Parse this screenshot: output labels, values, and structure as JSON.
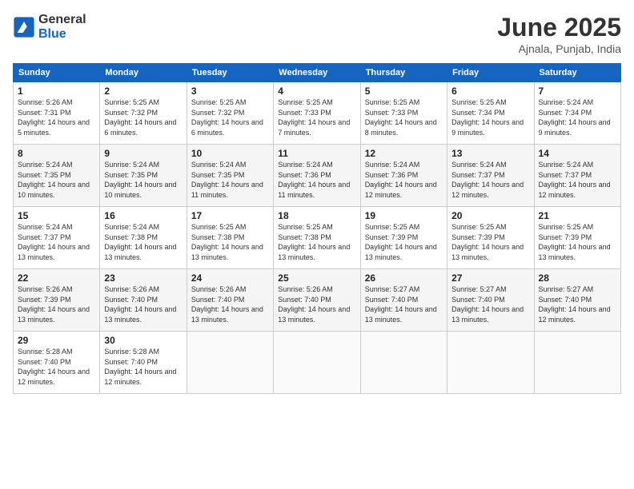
{
  "logo": {
    "general": "General",
    "blue": "Blue"
  },
  "title": "June 2025",
  "location": "Ajnala, Punjab, India",
  "weekdays": [
    "Sunday",
    "Monday",
    "Tuesday",
    "Wednesday",
    "Thursday",
    "Friday",
    "Saturday"
  ],
  "weeks": [
    [
      {
        "day": "1",
        "sunrise": "5:26 AM",
        "sunset": "7:31 PM",
        "daylight": "14 hours and 5 minutes."
      },
      {
        "day": "2",
        "sunrise": "5:25 AM",
        "sunset": "7:32 PM",
        "daylight": "14 hours and 6 minutes."
      },
      {
        "day": "3",
        "sunrise": "5:25 AM",
        "sunset": "7:32 PM",
        "daylight": "14 hours and 6 minutes."
      },
      {
        "day": "4",
        "sunrise": "5:25 AM",
        "sunset": "7:33 PM",
        "daylight": "14 hours and 7 minutes."
      },
      {
        "day": "5",
        "sunrise": "5:25 AM",
        "sunset": "7:33 PM",
        "daylight": "14 hours and 8 minutes."
      },
      {
        "day": "6",
        "sunrise": "5:25 AM",
        "sunset": "7:34 PM",
        "daylight": "14 hours and 9 minutes."
      },
      {
        "day": "7",
        "sunrise": "5:24 AM",
        "sunset": "7:34 PM",
        "daylight": "14 hours and 9 minutes."
      }
    ],
    [
      {
        "day": "8",
        "sunrise": "5:24 AM",
        "sunset": "7:35 PM",
        "daylight": "14 hours and 10 minutes."
      },
      {
        "day": "9",
        "sunrise": "5:24 AM",
        "sunset": "7:35 PM",
        "daylight": "14 hours and 10 minutes."
      },
      {
        "day": "10",
        "sunrise": "5:24 AM",
        "sunset": "7:35 PM",
        "daylight": "14 hours and 11 minutes."
      },
      {
        "day": "11",
        "sunrise": "5:24 AM",
        "sunset": "7:36 PM",
        "daylight": "14 hours and 11 minutes."
      },
      {
        "day": "12",
        "sunrise": "5:24 AM",
        "sunset": "7:36 PM",
        "daylight": "14 hours and 12 minutes."
      },
      {
        "day": "13",
        "sunrise": "5:24 AM",
        "sunset": "7:37 PM",
        "daylight": "14 hours and 12 minutes."
      },
      {
        "day": "14",
        "sunrise": "5:24 AM",
        "sunset": "7:37 PM",
        "daylight": "14 hours and 12 minutes."
      }
    ],
    [
      {
        "day": "15",
        "sunrise": "5:24 AM",
        "sunset": "7:37 PM",
        "daylight": "14 hours and 13 minutes."
      },
      {
        "day": "16",
        "sunrise": "5:24 AM",
        "sunset": "7:38 PM",
        "daylight": "14 hours and 13 minutes."
      },
      {
        "day": "17",
        "sunrise": "5:25 AM",
        "sunset": "7:38 PM",
        "daylight": "14 hours and 13 minutes."
      },
      {
        "day": "18",
        "sunrise": "5:25 AM",
        "sunset": "7:38 PM",
        "daylight": "14 hours and 13 minutes."
      },
      {
        "day": "19",
        "sunrise": "5:25 AM",
        "sunset": "7:39 PM",
        "daylight": "14 hours and 13 minutes."
      },
      {
        "day": "20",
        "sunrise": "5:25 AM",
        "sunset": "7:39 PM",
        "daylight": "14 hours and 13 minutes."
      },
      {
        "day": "21",
        "sunrise": "5:25 AM",
        "sunset": "7:39 PM",
        "daylight": "14 hours and 13 minutes."
      }
    ],
    [
      {
        "day": "22",
        "sunrise": "5:26 AM",
        "sunset": "7:39 PM",
        "daylight": "14 hours and 13 minutes."
      },
      {
        "day": "23",
        "sunrise": "5:26 AM",
        "sunset": "7:40 PM",
        "daylight": "14 hours and 13 minutes."
      },
      {
        "day": "24",
        "sunrise": "5:26 AM",
        "sunset": "7:40 PM",
        "daylight": "14 hours and 13 minutes."
      },
      {
        "day": "25",
        "sunrise": "5:26 AM",
        "sunset": "7:40 PM",
        "daylight": "14 hours and 13 minutes."
      },
      {
        "day": "26",
        "sunrise": "5:27 AM",
        "sunset": "7:40 PM",
        "daylight": "14 hours and 13 minutes."
      },
      {
        "day": "27",
        "sunrise": "5:27 AM",
        "sunset": "7:40 PM",
        "daylight": "14 hours and 13 minutes."
      },
      {
        "day": "28",
        "sunrise": "5:27 AM",
        "sunset": "7:40 PM",
        "daylight": "14 hours and 12 minutes."
      }
    ],
    [
      {
        "day": "29",
        "sunrise": "5:28 AM",
        "sunset": "7:40 PM",
        "daylight": "14 hours and 12 minutes."
      },
      {
        "day": "30",
        "sunrise": "5:28 AM",
        "sunset": "7:40 PM",
        "daylight": "14 hours and 12 minutes."
      },
      null,
      null,
      null,
      null,
      null
    ]
  ]
}
